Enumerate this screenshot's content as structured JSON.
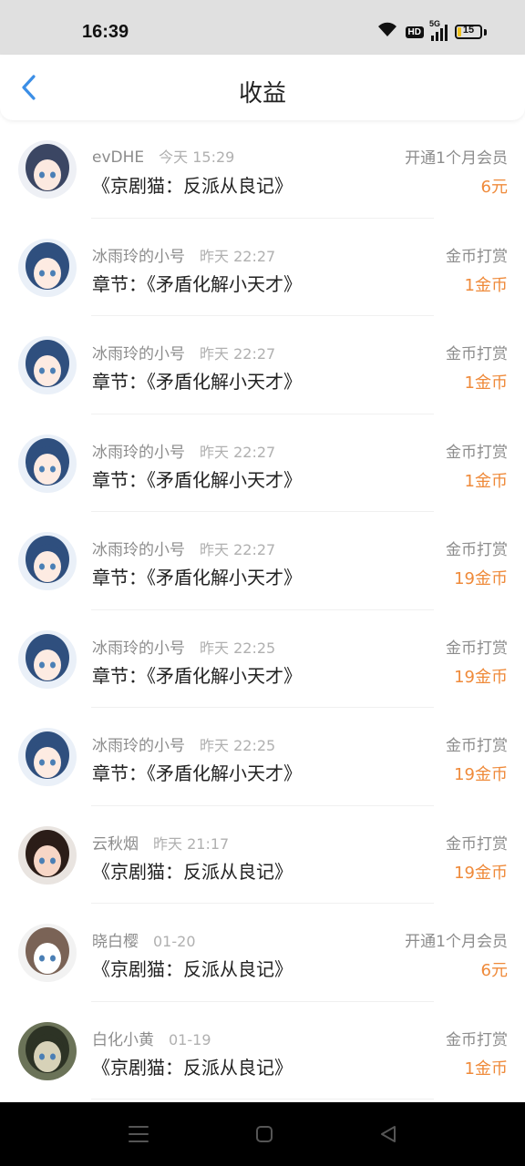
{
  "status_bar": {
    "time": "16:39",
    "battery": "15",
    "battery_level_percent": 15,
    "icons": [
      "wifi-icon",
      "hd-icon",
      "5g-signal-icon",
      "battery-icon"
    ],
    "hd_label": "HD",
    "network_label": "5G"
  },
  "header": {
    "title": "收益",
    "back_icon": "chevron-left-icon"
  },
  "colors": {
    "accent_blue": "#3b8ee6",
    "amount_orange": "#ef8a3a",
    "nav_bar": "#000000"
  },
  "records": [
    {
      "user": "evDHE",
      "time": "今天 15:29",
      "work": "《京剧猫：反派从良记》",
      "type": "开通1个月会员",
      "amount": "6元"
    },
    {
      "user": "冰雨玲的小号",
      "time": "昨天 22:27",
      "work": "章节：《矛盾化解小天才》",
      "type": "金币打赏",
      "amount": "1金币"
    },
    {
      "user": "冰雨玲的小号",
      "time": "昨天 22:27",
      "work": "章节：《矛盾化解小天才》",
      "type": "金币打赏",
      "amount": "1金币"
    },
    {
      "user": "冰雨玲的小号",
      "time": "昨天 22:27",
      "work": "章节：《矛盾化解小天才》",
      "type": "金币打赏",
      "amount": "1金币"
    },
    {
      "user": "冰雨玲的小号",
      "time": "昨天 22:27",
      "work": "章节：《矛盾化解小天才》",
      "type": "金币打赏",
      "amount": "19金币"
    },
    {
      "user": "冰雨玲的小号",
      "time": "昨天 22:25",
      "work": "章节：《矛盾化解小天才》",
      "type": "金币打赏",
      "amount": "19金币"
    },
    {
      "user": "冰雨玲的小号",
      "time": "昨天 22:25",
      "work": "章节：《矛盾化解小天才》",
      "type": "金币打赏",
      "amount": "19金币"
    },
    {
      "user": "云秋烟",
      "time": "昨天 21:17",
      "work": "《京剧猫：反派从良记》",
      "type": "金币打赏",
      "amount": "19金币"
    },
    {
      "user": "晓白樱",
      "time": "01-20",
      "work": "《京剧猫：反派从良记》",
      "type": "开通1个月会员",
      "amount": "6元"
    },
    {
      "user": "白化小黄",
      "time": "01-19",
      "work": "《京剧猫：反派从良记》",
      "type": "金币打赏",
      "amount": "1金币"
    }
  ],
  "nav_bar": {
    "buttons": [
      "menu-icon",
      "home-icon",
      "back-triangle-icon"
    ]
  }
}
